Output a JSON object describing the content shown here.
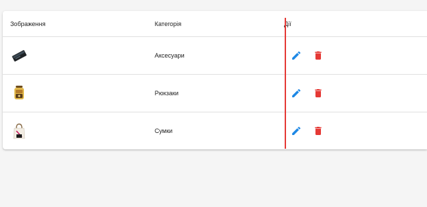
{
  "table": {
    "headers": {
      "image": "Зображення",
      "category": "Категорія",
      "actions": "Дії"
    },
    "rows": [
      {
        "category": "Аксесуари",
        "thumb_icon": "accessory-case-icon"
      },
      {
        "category": "Рюкзаки",
        "thumb_icon": "backpack-icon"
      },
      {
        "category": "Сумки",
        "thumb_icon": "tote-bag-icon"
      }
    ],
    "icons": {
      "edit": "pencil-icon",
      "delete": "trash-icon"
    }
  },
  "colors": {
    "edit": "#1e88e5",
    "delete": "#e53935",
    "divider_accent": "#e53935",
    "text": "#212121"
  }
}
